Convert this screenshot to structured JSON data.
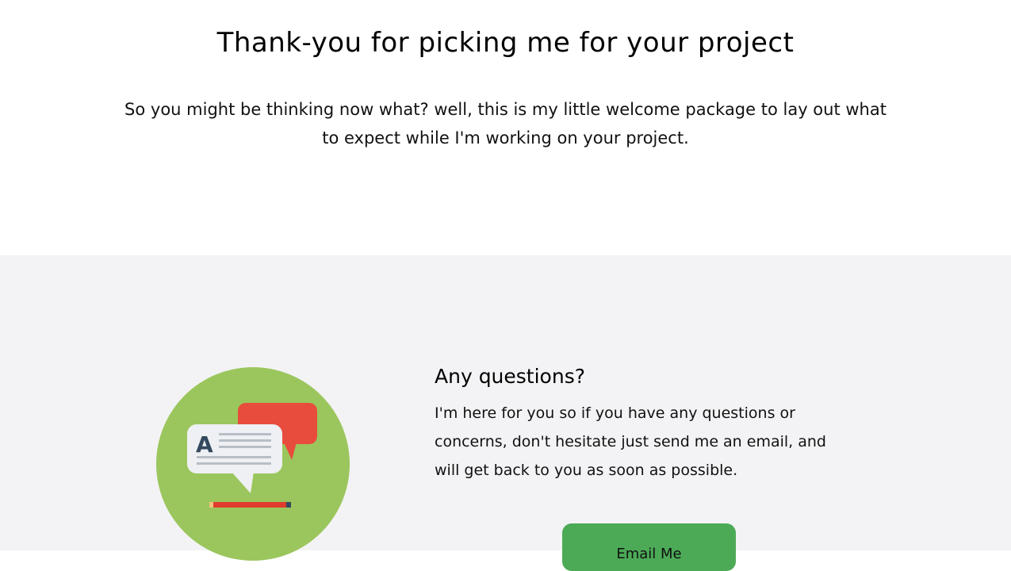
{
  "hero": {
    "title": "Thank-you for picking me for your project",
    "intro": "So you might be thinking now what? well, this is my little welcome package to lay out what to expect while I'm working on your project."
  },
  "questions": {
    "heading": "Any questions?",
    "body": "I'm here for you so if you have any questions or concerns, don't hesitate just send me an email, and will get back to you as soon as possible.",
    "button_label": "Email Me"
  },
  "colors": {
    "section_bg": "#f3f3f5",
    "circle_green": "#9bc65d",
    "bubble_red": "#e74c3c",
    "bubble_white": "#eef0f3",
    "pencil_red": "#e03c2e",
    "button_green": "#4caa57"
  },
  "icons": {
    "illustration": "chat-bubbles-icon"
  }
}
